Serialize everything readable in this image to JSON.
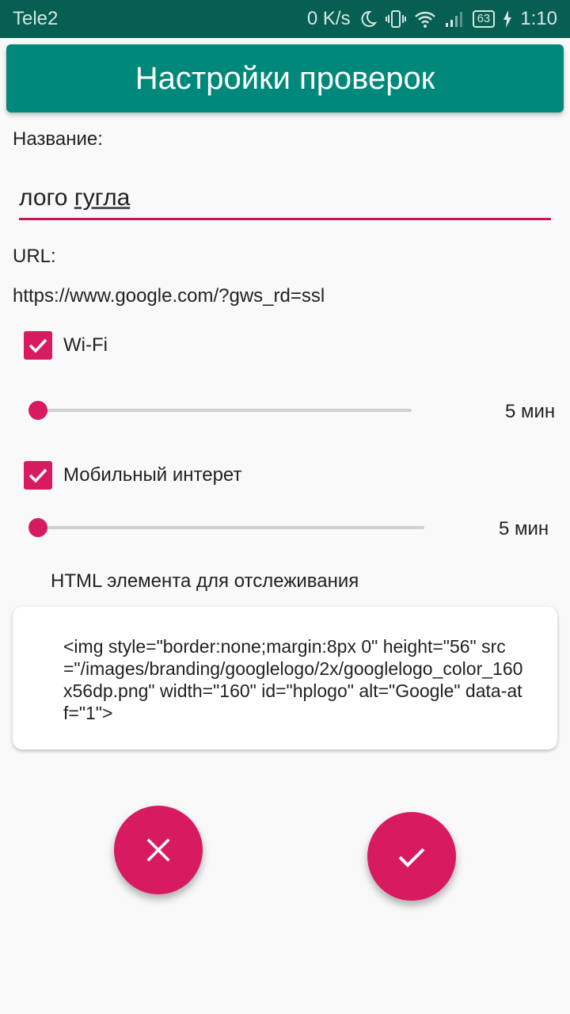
{
  "status_bar": {
    "carrier": "Tele2",
    "speed": "0 K/s",
    "battery": "63",
    "time": "1:10"
  },
  "app_bar": {
    "title": "Настройки проверок"
  },
  "form": {
    "name_label": "Название:",
    "name_value_1": "лого",
    "name_value_2": "гугла",
    "url_label": "URL:",
    "url_value": "https://www.google.com/?gws_rd=ssl",
    "wifi": {
      "label": "Wi-Fi",
      "checked": true,
      "interval": "5 мин",
      "slider_level": 0
    },
    "mobile": {
      "label": "Мобильный интерет",
      "checked": true,
      "interval": "5 мин",
      "slider_level": 0
    },
    "html_label": "HTML элемента для отслеживания",
    "html_value": "<img style=\"border:none;margin:8px 0\" height=\"56\" src=\"/images/branding/googlelogo/2x/googlelogo_color_160x56dp.png\" width=\"160\" id=\"hplogo\" alt=\"Google\" data-atf=\"1\">"
  },
  "actions": {
    "cancel_icon": "close-icon",
    "confirm_icon": "check-icon"
  },
  "colors": {
    "primary": "#00897b",
    "status_bar": "#075e52",
    "accent": "#d81b60"
  }
}
